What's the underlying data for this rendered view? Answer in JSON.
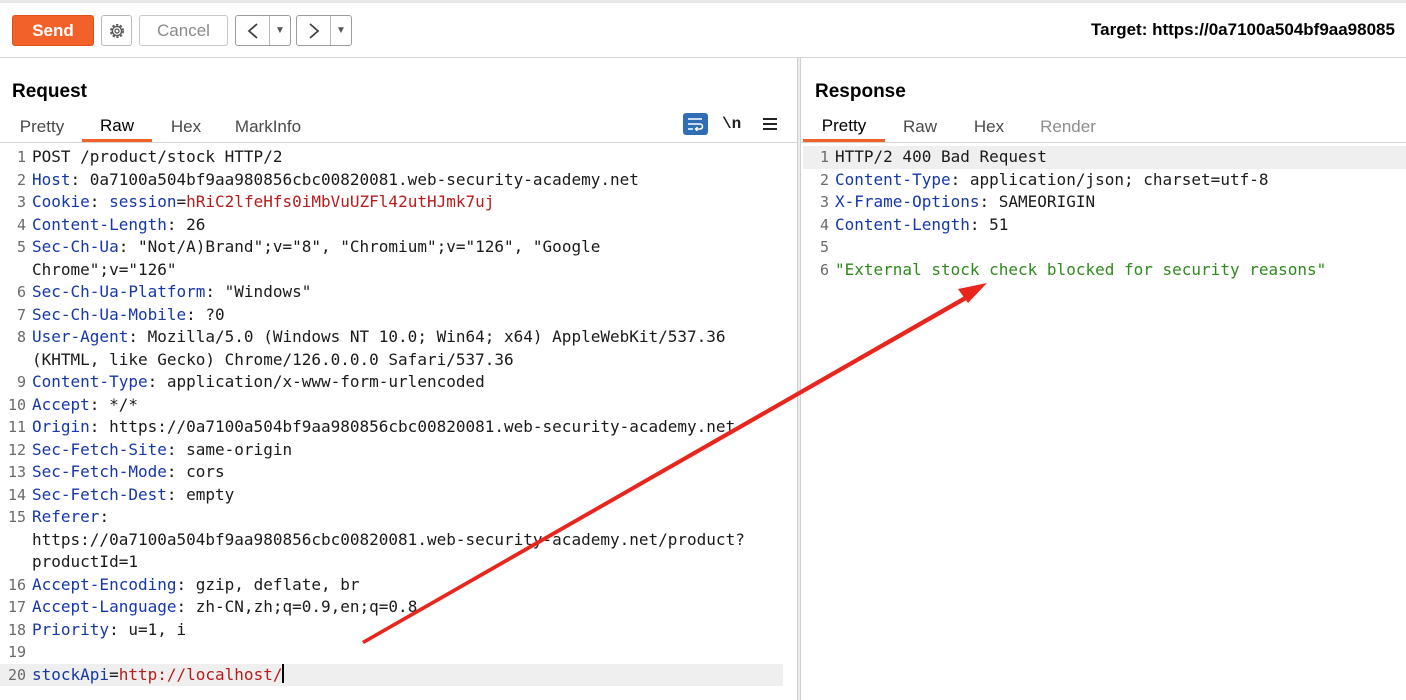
{
  "toolbar": {
    "send_label": "Send",
    "cancel_label": "Cancel",
    "target_text": "Target: https://0a7100a504bf9aa98085"
  },
  "request": {
    "title": "Request",
    "tabs": [
      "Pretty",
      "Raw",
      "Hex",
      "MarkInfo"
    ],
    "active_tab": "Raw",
    "newline_toggle": "\\n",
    "lines": [
      {
        "n": "1",
        "text": "POST /product/stock HTTP/2"
      },
      {
        "n": "2",
        "key": "Host",
        "val": ": 0a7100a504bf9aa980856cbc00820081.web-security-academy.net"
      },
      {
        "n": "3",
        "key": "Cookie",
        "sep": ": ",
        "ckey": "session",
        "eq": "=",
        "cval": "hRiC2lfeHfs0iMbVuUZFl42utHJmk7uj"
      },
      {
        "n": "4",
        "key": "Content-Length",
        "val": ": 26"
      },
      {
        "n": "5",
        "key": "Sec-Ch-Ua",
        "val": ": \"Not/A)Brand\";v=\"8\", \"Chromium\";v=\"126\", \"Google"
      },
      {
        "n": "",
        "text": "Chrome\";v=\"126\""
      },
      {
        "n": "6",
        "key": "Sec-Ch-Ua-Platform",
        "val": ": \"Windows\""
      },
      {
        "n": "7",
        "key": "Sec-Ch-Ua-Mobile",
        "val": ": ?0"
      },
      {
        "n": "8",
        "key": "User-Agent",
        "val": ": Mozilla/5.0 (Windows NT 10.0; Win64; x64) AppleWebKit/537.36"
      },
      {
        "n": "",
        "text": "(KHTML, like Gecko) Chrome/126.0.0.0 Safari/537.36"
      },
      {
        "n": "9",
        "key": "Content-Type",
        "val": ": application/x-www-form-urlencoded"
      },
      {
        "n": "10",
        "key": "Accept",
        "val": ": */*"
      },
      {
        "n": "11",
        "key": "Origin",
        "val": ": https://0a7100a504bf9aa980856cbc00820081.web-security-academy.net"
      },
      {
        "n": "12",
        "key": "Sec-Fetch-Site",
        "val": ": same-origin"
      },
      {
        "n": "13",
        "key": "Sec-Fetch-Mode",
        "val": ": cors"
      },
      {
        "n": "14",
        "key": "Sec-Fetch-Dest",
        "val": ": empty"
      },
      {
        "n": "15",
        "key": "Referer",
        "val": ":"
      },
      {
        "n": "",
        "text": "https://0a7100a504bf9aa980856cbc00820081.web-security-academy.net/product?"
      },
      {
        "n": "",
        "text": "productId=1"
      },
      {
        "n": "16",
        "key": "Accept-Encoding",
        "val": ": gzip, deflate, br"
      },
      {
        "n": "17",
        "key": "Accept-Language",
        "val": ": zh-CN,zh;q=0.9,en;q=0.8"
      },
      {
        "n": "18",
        "key": "Priority",
        "val": ": u=1, i"
      },
      {
        "n": "19",
        "text": ""
      },
      {
        "n": "20",
        "pkey": "stockApi",
        "eq": "=",
        "pval": "http://localhost/"
      }
    ]
  },
  "response": {
    "title": "Response",
    "tabs": [
      "Pretty",
      "Raw",
      "Hex",
      "Render"
    ],
    "active_tab": "Pretty",
    "lines": [
      {
        "n": "1",
        "text": "HTTP/2 400 Bad Request"
      },
      {
        "n": "2",
        "key": "Content-Type",
        "val": ": application/json; charset=utf-8"
      },
      {
        "n": "3",
        "key": "X-Frame-Options",
        "val": ": SAMEORIGIN"
      },
      {
        "n": "4",
        "key": "Content-Length",
        "val": ": 51"
      },
      {
        "n": "5",
        "text": ""
      },
      {
        "n": "6",
        "str": "\"External stock check blocked for security reasons\""
      }
    ]
  },
  "colors": {
    "accent": "#f2612a",
    "header_key": "#1537a8",
    "cookie_value": "#b71b1b",
    "json_string": "#2f8a1c",
    "annotation_arrow": "#e8261d"
  }
}
